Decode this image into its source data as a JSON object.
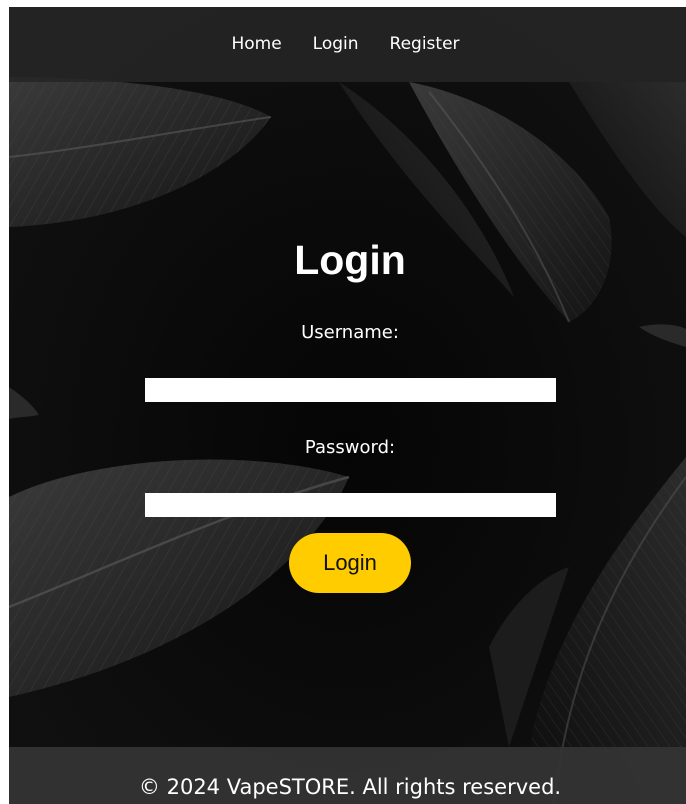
{
  "nav": {
    "items": [
      {
        "label": "Home"
      },
      {
        "label": "Login"
      },
      {
        "label": "Register"
      }
    ]
  },
  "form": {
    "title": "Login",
    "username_label": "Username:",
    "username_value": "",
    "password_label": "Password:",
    "password_value": "",
    "submit_label": "Login"
  },
  "footer": {
    "text": "© 2024 VapeSTORE. All rights reserved."
  },
  "colors": {
    "background": "#070707",
    "accent": "#ffcc00",
    "text": "#ffffff"
  },
  "background_image": "dark-tropical-leaves"
}
